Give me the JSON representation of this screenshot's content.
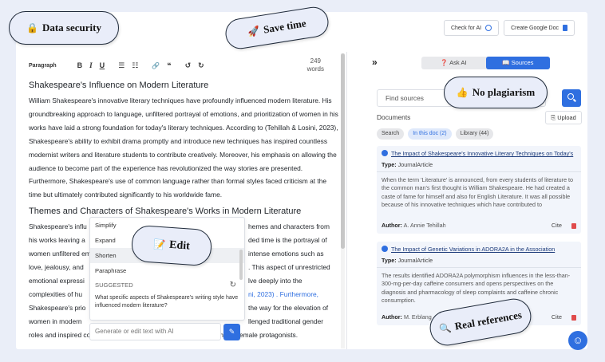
{
  "top_buttons": {
    "check_ai": "Check for AI",
    "create_doc": "Create Google Doc"
  },
  "toolbar": {
    "paragraph": "Paragraph",
    "bold": "B",
    "italic": "I",
    "underline": "U",
    "bullets": "☰",
    "numbers": "☷",
    "link": "🔗",
    "quote": "❝",
    "undo": "↺",
    "redo": "↻",
    "word_count_num": "249",
    "word_count_unit": "words"
  },
  "doc": {
    "heading1": "Shakespeare's Influence on Modern Literature",
    "para1": "William Shakespeare's innovative literary techniques have profoundly influenced modern literature. His groundbreaking approach to language, unfiltered portrayal of emotions, and prioritization of women in his works have laid a strong foundation for today's literary techniques. According to (Tehillah & Losini, 2023), Shakespeare's ability to exhibit drama promptly and introduce new techniques has inspired countless modernist writers and literature students to contribute creatively. Moreover, his emphasis on allowing the audience to become part of the experience has revolutionized the way stories are presented. Furthermore, Shakespeare's use of common language rather than formal styles faced criticism at the time but ultimately contributed significantly to his worldwide fame.",
    "heading2": "Themes and Characters of Shakespeare's Works in Modern Literature",
    "para2_lines": [
      "Shakespeare's influ",
      "his works leaving a",
      "women unfiltered emotio",
      "love, jealousy, and",
      "emotional expressi",
      "complexities of hu",
      "Shakespeare's prio",
      "women in modern",
      "roles and inspired contemporary authors to depict strong and complex female protagonists."
    ],
    "para2_right": [
      "hemes and characters from",
      "ded time is the portrayal of",
      "intense emotions such as",
      ". This aspect of unrestricted",
      "lve deeply into the",
      "ni, 2023) . Furthermore,",
      "the way for the elevation of",
      "llenged traditional gender"
    ]
  },
  "menu": {
    "items": [
      "Simplify",
      "Expand",
      "Shorten",
      "Paraphrase"
    ],
    "suggested_label": "SUGGESTED",
    "suggestion": "What specific aspects of Shakespeare's writing style have influenced modern literature?",
    "refresh": "↻"
  },
  "generate": {
    "placeholder": "Generate or edit text with AI",
    "button": "✎"
  },
  "side": {
    "collapse": "»",
    "tab_ask": "Ask AI",
    "tab_sources": "Sources",
    "search_placeholder": "Find sources",
    "documents": "Documents",
    "upload": "Upload",
    "chips": [
      "Search",
      "In this doc (2)",
      "Library (44)"
    ],
    "refs": [
      {
        "title": "The Impact of Shakespeare's Innovative Literary Techniques on Today's",
        "type_label": "Type:",
        "type": "JournalArticle",
        "abstract": "When the term 'Literature' is announced, from every students of literature to the common man's first thought is William Shakespeare. He had created a caste of fame for himself and also for English Literature. It was all possible because of his innovative techniques which have contributed to",
        "author_label": "Author:",
        "author": "A. Annie Tehillah",
        "cite": "Cite"
      },
      {
        "title": "The Impact of Genetic Variations in ADORA2A in the Association",
        "type_label": "Type:",
        "type": "JournalArticle",
        "abstract": "The results identified ADORA2A polymorphism influences in the less-than-300-mg-per-day caffeine consumers and opens perspectives on the diagnosis and pharmacology of sleep complaints and caffeine chronic consumption.",
        "author_label": "Author:",
        "author": "M. Erblang",
        "cite": "Cite"
      }
    ]
  },
  "help": "☺",
  "badges": {
    "security": "Data security",
    "time": "Save time",
    "plagiarism": "No plagiarism",
    "edit": "Edit",
    "references": "Real references"
  },
  "badge_icons": {
    "security": "🔒",
    "time": "🚀",
    "plagiarism": "👍",
    "edit": "📝",
    "references": "🔍"
  },
  "colors": {
    "accent": "#2f6fe0",
    "background": "#eaeef8",
    "badge": "#e9edf9"
  }
}
